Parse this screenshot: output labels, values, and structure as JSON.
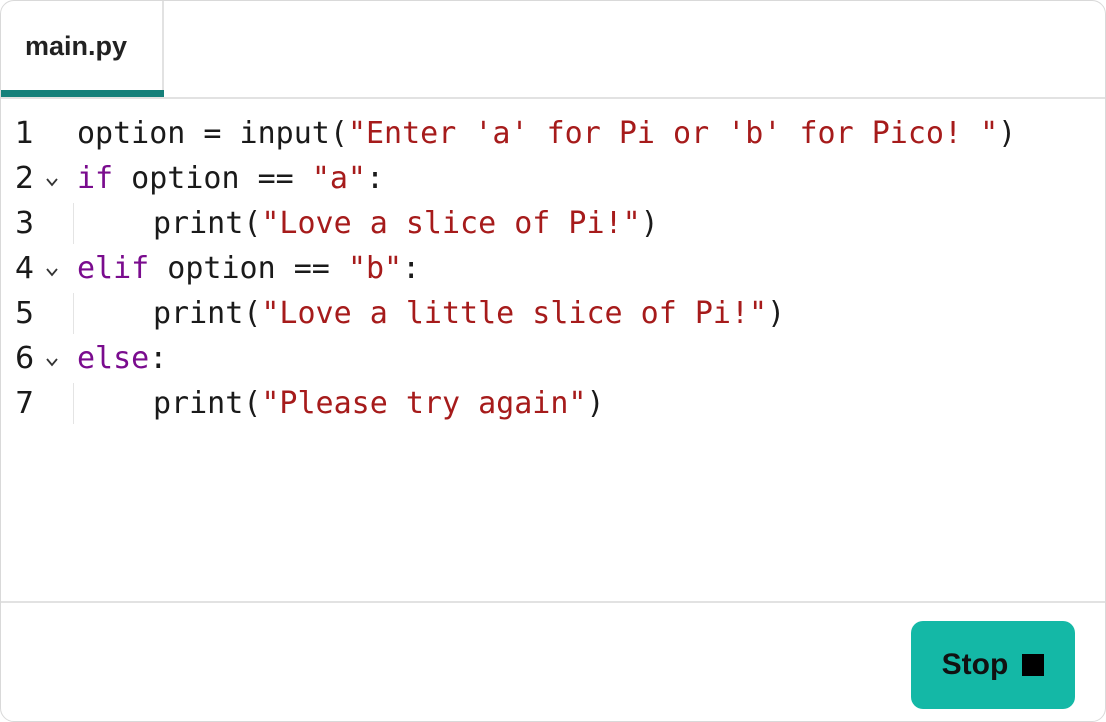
{
  "tab": {
    "label": "main.py",
    "accent_color": "#15807a"
  },
  "editor": {
    "lines": [
      {
        "number": "1",
        "foldable": false,
        "indented": false,
        "tokens": [
          {
            "type": "plain",
            "text": "option = input("
          },
          {
            "type": "str",
            "text": "\"Enter 'a' for Pi or 'b' for Pico! \""
          },
          {
            "type": "plain",
            "text": ")"
          }
        ]
      },
      {
        "number": "2",
        "foldable": true,
        "indented": false,
        "tokens": [
          {
            "type": "kw",
            "text": "if"
          },
          {
            "type": "plain",
            "text": " option == "
          },
          {
            "type": "str",
            "text": "\"a\""
          },
          {
            "type": "plain",
            "text": ":"
          }
        ]
      },
      {
        "number": "3",
        "foldable": false,
        "indented": true,
        "tokens": [
          {
            "type": "plain",
            "text": "print("
          },
          {
            "type": "str",
            "text": "\"Love a slice of Pi!\""
          },
          {
            "type": "plain",
            "text": ")"
          }
        ]
      },
      {
        "number": "4",
        "foldable": true,
        "indented": false,
        "tokens": [
          {
            "type": "kw",
            "text": "elif"
          },
          {
            "type": "plain",
            "text": " option == "
          },
          {
            "type": "str",
            "text": "\"b\""
          },
          {
            "type": "plain",
            "text": ":"
          }
        ]
      },
      {
        "number": "5",
        "foldable": false,
        "indented": true,
        "tokens": [
          {
            "type": "plain",
            "text": "print("
          },
          {
            "type": "str",
            "text": "\"Love a little slice of Pi!\""
          },
          {
            "type": "plain",
            "text": ")"
          }
        ]
      },
      {
        "number": "6",
        "foldable": true,
        "indented": false,
        "tokens": [
          {
            "type": "kw",
            "text": "else"
          },
          {
            "type": "plain",
            "text": ":"
          }
        ]
      },
      {
        "number": "7",
        "foldable": false,
        "indented": true,
        "tokens": [
          {
            "type": "plain",
            "text": "print("
          },
          {
            "type": "str",
            "text": "\"Please try again\""
          },
          {
            "type": "plain",
            "text": ")"
          }
        ]
      }
    ]
  },
  "footer": {
    "stop_label": "Stop",
    "stop_color": "#14b8a6"
  },
  "colors": {
    "keyword": "#7a0c8e",
    "string": "#a61b1b",
    "text": "#1a1a1a"
  }
}
